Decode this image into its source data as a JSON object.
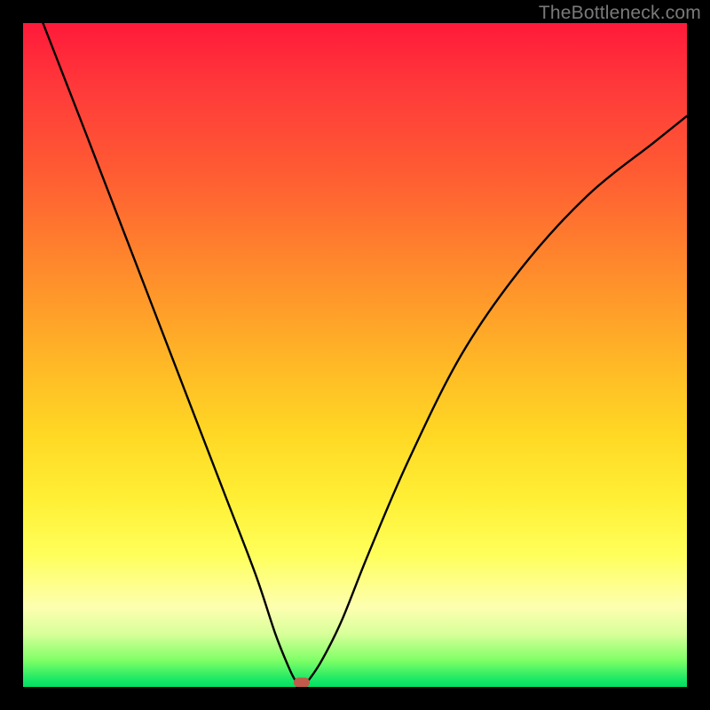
{
  "watermark": "TheBottleneck.com",
  "colors": {
    "frame": "#000000",
    "curve": "#000000",
    "marker": "#c05a4a",
    "gradient_top": "#ff1a3a",
    "gradient_bottom": "#00e060"
  },
  "chart_data": {
    "type": "line",
    "title": "",
    "xlabel": "",
    "ylabel": "",
    "xlim": [
      0,
      100
    ],
    "ylim": [
      0,
      100
    ],
    "grid": false,
    "legend": false,
    "series": [
      {
        "name": "bottleneck-curve",
        "x": [
          3,
          10,
          20,
          30,
          35,
          38,
          40,
          41,
          42,
          43,
          45,
          48,
          52,
          58,
          66,
          75,
          85,
          95,
          100
        ],
        "y": [
          100,
          82,
          56,
          30,
          17,
          8,
          3,
          1,
          0,
          1,
          4,
          10,
          20,
          34,
          50,
          63,
          74,
          82,
          86
        ]
      }
    ],
    "marker": {
      "x": 42,
      "y": 0.7,
      "shape": "rounded-rect",
      "color": "#c05a4a"
    },
    "annotations": [
      {
        "text": "TheBottleneck.com",
        "role": "watermark",
        "position": "top-right"
      }
    ]
  }
}
